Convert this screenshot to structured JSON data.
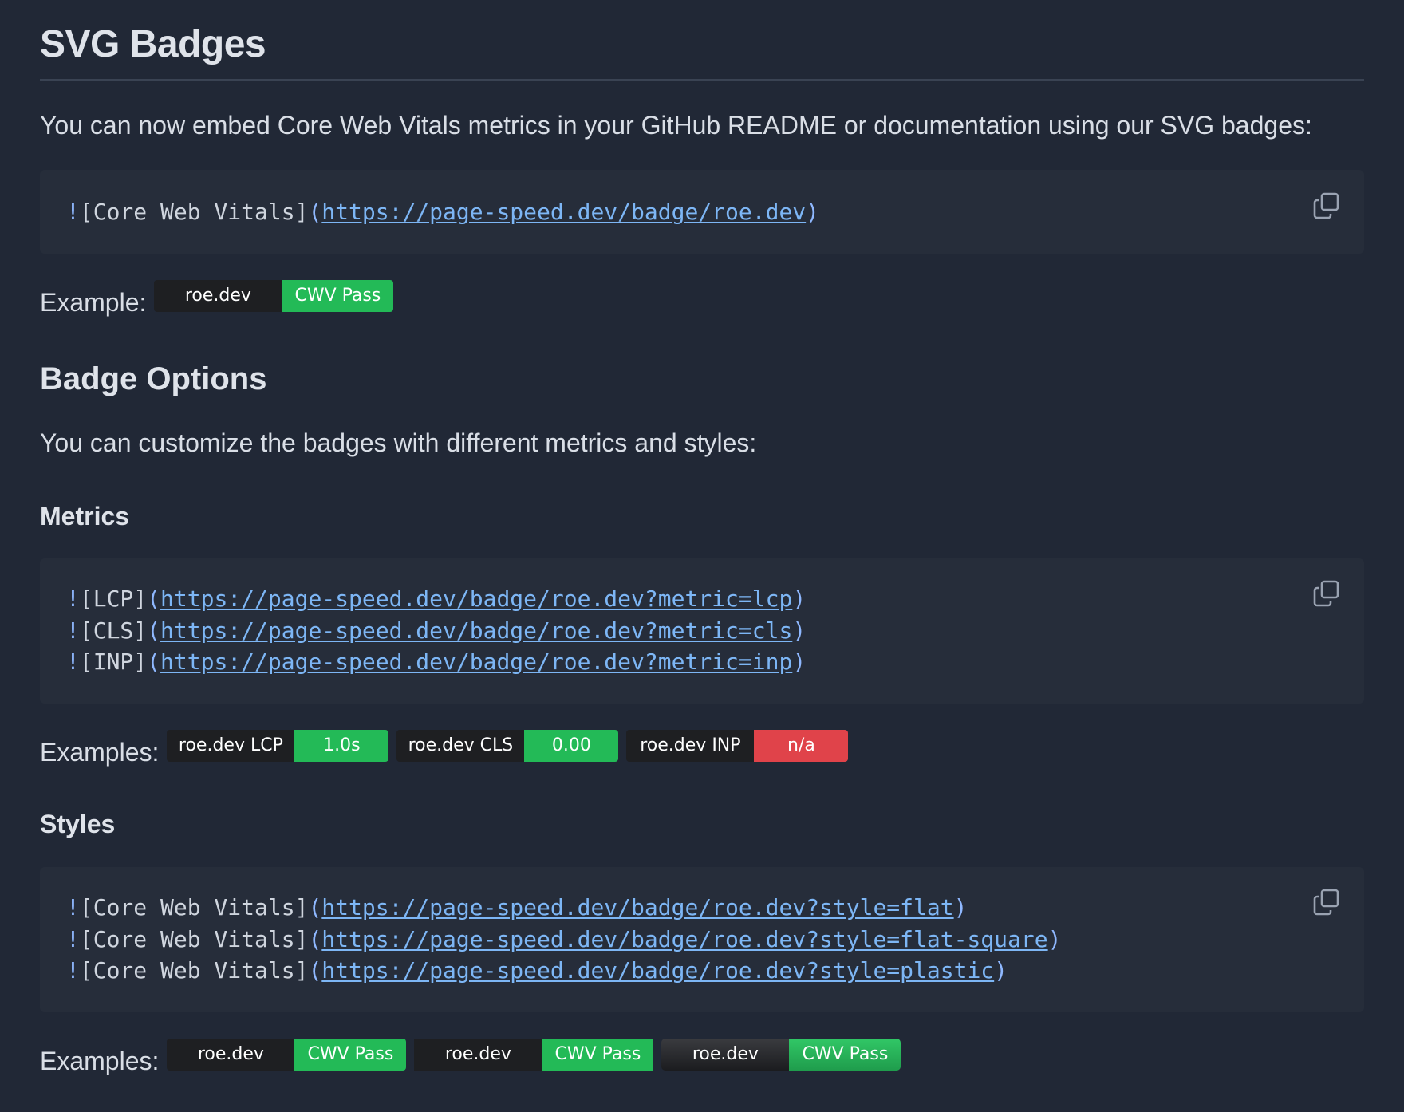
{
  "page": {
    "title": "SVG Badges",
    "intro": "You can now embed Core Web Vitals metrics in your GitHub README or documentation using our SVG badges:",
    "colors": {
      "background": "#212836",
      "code_background": "#262d3a",
      "link": "#7db6f5",
      "badge_label": "#1e1f22",
      "badge_good": "#23ba57",
      "badge_bad": "#e0434a"
    }
  },
  "basic": {
    "code": [
      {
        "bang": "!",
        "alt": "[Core Web Vitals]",
        "open": "(",
        "url": "https://page-speed.dev/badge/roe.dev",
        "close": ")"
      }
    ],
    "copy_icon": "copy-icon",
    "example_label": "Example:",
    "badge": {
      "label": "roe.dev",
      "value": "CWV Pass",
      "status": "good"
    }
  },
  "options": {
    "heading": "Badge Options",
    "intro": "You can customize the badges with different metrics and styles:"
  },
  "metrics": {
    "heading": "Metrics",
    "code": [
      {
        "bang": "!",
        "alt": "[LCP]",
        "open": "(",
        "url": "https://page-speed.dev/badge/roe.dev?metric=lcp",
        "close": ")"
      },
      {
        "bang": "!",
        "alt": "[CLS]",
        "open": "(",
        "url": "https://page-speed.dev/badge/roe.dev?metric=cls",
        "close": ")"
      },
      {
        "bang": "!",
        "alt": "[INP]",
        "open": "(",
        "url": "https://page-speed.dev/badge/roe.dev?metric=inp",
        "close": ")"
      }
    ],
    "copy_icon": "copy-icon",
    "example_label": "Examples:",
    "badges": [
      {
        "label": "roe.dev LCP",
        "value": "1.0s",
        "status": "good"
      },
      {
        "label": "roe.dev CLS",
        "value": "0.00",
        "status": "good"
      },
      {
        "label": "roe.dev INP",
        "value": "n/a",
        "status": "bad"
      }
    ]
  },
  "styles": {
    "heading": "Styles",
    "code": [
      {
        "bang": "!",
        "alt": "[Core Web Vitals]",
        "open": "(",
        "url": "https://page-speed.dev/badge/roe.dev?style=flat",
        "close": ")"
      },
      {
        "bang": "!",
        "alt": "[Core Web Vitals]",
        "open": "(",
        "url": "https://page-speed.dev/badge/roe.dev?style=flat-square",
        "close": ")"
      },
      {
        "bang": "!",
        "alt": "[Core Web Vitals]",
        "open": "(",
        "url": "https://page-speed.dev/badge/roe.dev?style=plastic",
        "close": ")"
      }
    ],
    "copy_icon": "copy-icon",
    "example_label": "Examples:",
    "badges": [
      {
        "label": "roe.dev",
        "value": "CWV Pass",
        "status": "good",
        "style": "flat"
      },
      {
        "label": "roe.dev",
        "value": "CWV Pass",
        "status": "good",
        "style": "flat-square"
      },
      {
        "label": "roe.dev",
        "value": "CWV Pass",
        "status": "good",
        "style": "plastic"
      }
    ]
  }
}
